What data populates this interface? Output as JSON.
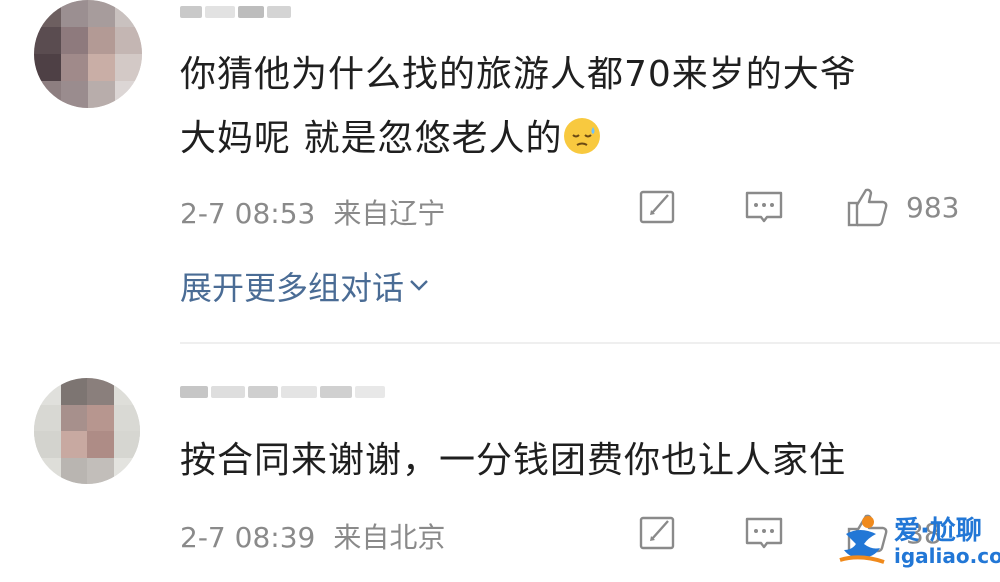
{
  "comments": [
    {
      "line1": "你猜他为什么找的旅游人都70来岁的大爷",
      "line2": "大妈呢 就是忽悠老人的",
      "time": "2-7 08:53",
      "location": "来自辽宁",
      "likes": "983",
      "expand": "展开更多组对话"
    },
    {
      "line1": "按合同来谢谢，一分钱团费你也让人家住",
      "time": "2-7 08:39",
      "location": "来自北京",
      "likes": "38"
    }
  ],
  "icons": {
    "share": "share-icon",
    "reply": "comment-icon",
    "like": "thumbs-up-icon",
    "expand": "chevron-down-icon",
    "emoji": "sweat-smile-emoji"
  },
  "watermark": {
    "title": "爱·尬聊",
    "url": "igaliao.com"
  },
  "colors": {
    "text": "#1f1f1f",
    "meta": "#8a8a8a",
    "link": "#4a6c95",
    "watermark": "#2277d6"
  }
}
